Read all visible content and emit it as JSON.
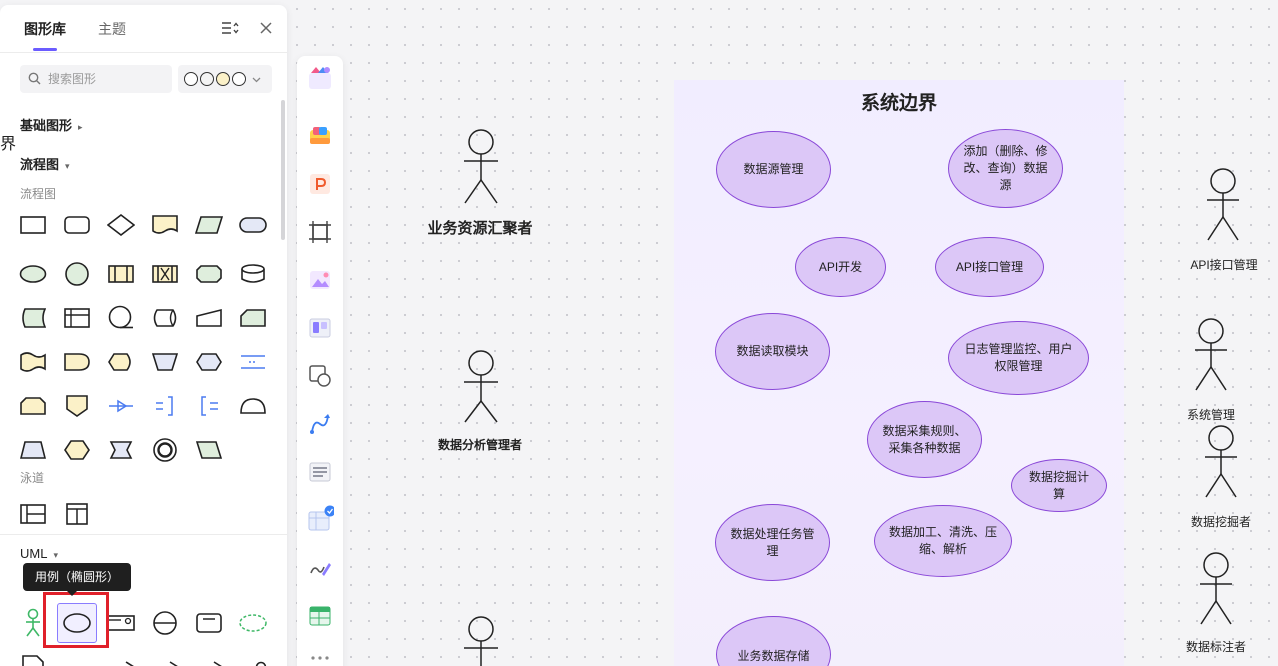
{
  "panel": {
    "tabs": [
      {
        "label": "图形库",
        "active": true
      },
      {
        "label": "主题",
        "active": false
      }
    ],
    "search": {
      "placeholder": "搜索图形"
    },
    "sections": {
      "basic": "基础图形",
      "flowchart": "流程图",
      "flowchart_sub": "流程图",
      "swimlane_sub": "泳道",
      "uml": "UML"
    },
    "tooltip": "用例（椭圆形）"
  },
  "canvas": {
    "edge_char": "界",
    "boundary_title": "系统边界",
    "use_cases": [
      {
        "label": "数据源管理"
      },
      {
        "label": "添加（删除、修改、查询）数据源"
      },
      {
        "label": "API开发"
      },
      {
        "label": "API接口管理"
      },
      {
        "label": "数据读取模块"
      },
      {
        "label": "日志管理监控、用户权限管理"
      },
      {
        "label": "数据采集规则、采集各种数据"
      },
      {
        "label": "数据挖掘计算"
      },
      {
        "label": "数据处理任务管理"
      },
      {
        "label": "数据加工、清洗、压缩、解析"
      },
      {
        "label": "业务数据存储"
      }
    ],
    "actors": [
      {
        "label": "业务资源汇聚者"
      },
      {
        "label": "数据分析管理者"
      },
      {
        "label": "API接口管理"
      },
      {
        "label": "系统管理"
      },
      {
        "label": "数据挖掘者"
      },
      {
        "label": "数据标注者"
      }
    ]
  },
  "colors": {
    "accent": "#6b5cff",
    "use_case_fill": "#dcc7f7",
    "use_case_stroke": "#8a48d8",
    "highlight": "#e0202a"
  }
}
